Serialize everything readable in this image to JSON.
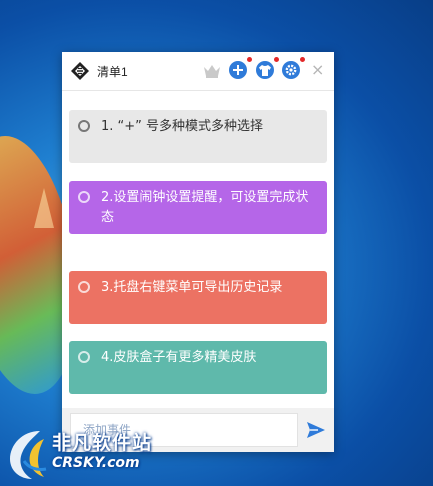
{
  "window": {
    "title": "清单1"
  },
  "toolbar": {
    "icons": [
      "crown-icon",
      "add-icon",
      "skin-icon",
      "settings-icon",
      "close-icon"
    ],
    "close_glyph": "×",
    "accent": "#2f7bd9",
    "badge_color": "#e32828"
  },
  "tasks": [
    {
      "text": "1. “+” 号多种模式多种选择",
      "bg": "#e8e8e8",
      "color": "#333333"
    },
    {
      "text": "2.设置闹钟设置提醒，可设置完成状态",
      "bg": "#b566e8",
      "color": "#ffffff"
    },
    {
      "text": "3.托盘右键菜单可导出历史记录",
      "bg": "#ec7263",
      "color": "#ffffff"
    },
    {
      "text": "4.皮肤盒子有更多精美皮肤",
      "bg": "#5fb9ab",
      "color": "#ffffff"
    }
  ],
  "footer": {
    "placeholder": "添加事件"
  },
  "watermark": {
    "cn": "非凡软件站",
    "en": "CRSKY.com"
  }
}
